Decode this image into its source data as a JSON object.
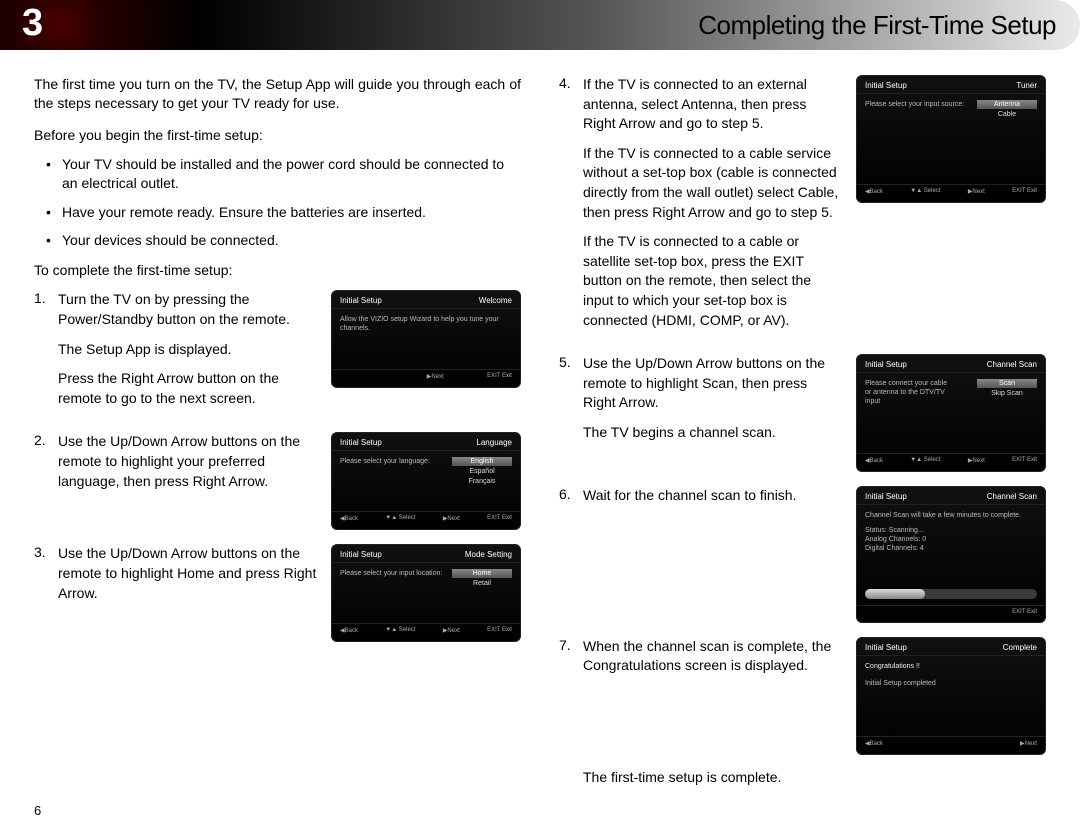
{
  "chapter": "3",
  "title": "Completing the First-Time Setup",
  "page_number": "6",
  "intro": "The first time you turn on the TV, the Setup App will guide you through each of the steps necessary to get your TV ready for use.",
  "before_label": "Before you begin the first-time setup:",
  "bullets": [
    "Your TV should be installed and the power cord should be connected to an electrical outlet.",
    "Have your remote ready. Ensure the batteries are inserted.",
    "Your devices should be connected."
  ],
  "complete_label": "To complete the first-time setup:",
  "steps_left": [
    {
      "lines": [
        "Turn the TV on by pressing the Power/Standby button on the remote.",
        "The Setup App is displayed.",
        "Press the Right Arrow button on the remote to go to the next screen."
      ],
      "tv": {
        "title": "Initial Setup",
        "sub": "Welcome",
        "msg": "Allow the VIZIO setup Wizard to help you tune your channels.",
        "footer": [
          "",
          "",
          "▶Next",
          "EXIT Exit"
        ]
      }
    },
    {
      "lines": [
        "Use the Up/Down Arrow buttons on the remote to highlight your preferred language, then press Right Arrow."
      ],
      "tv": {
        "title": "Initial Setup",
        "sub": "Language",
        "msg": "Please select your language:",
        "options": [
          "English",
          "Español",
          "Français"
        ],
        "footer": [
          "◀Back",
          "▼▲ Select",
          "▶Next",
          "EXIT Exit"
        ]
      }
    },
    {
      "lines": [
        "Use the Up/Down Arrow buttons on the remote to highlight Home and press Right Arrow."
      ],
      "tv": {
        "title": "Initial Setup",
        "sub": "Mode Setting",
        "msg": "Please select your input location:",
        "options": [
          "Home",
          "Retail"
        ],
        "footer": [
          "◀Back",
          "▼▲ Select",
          "▶Next",
          "EXIT Exit"
        ]
      }
    }
  ],
  "steps_right": [
    {
      "lines": [
        "If the TV is connected to an external antenna, select Antenna, then press Right Arrow and go to step 5.",
        "If the TV is connected to a cable service without a set-top box (cable is connected directly from the wall outlet) select Cable, then press Right Arrow and go to step 5.",
        "If the TV is connected to a cable or satellite set-top box, press the EXIT button on the remote, then select the input to which your set-top box is connected (HDMI, COMP, or AV)."
      ],
      "tv": {
        "title": "Initial Setup",
        "sub": "Tuner",
        "msg": "Please select your input source:",
        "options": [
          "Antenna",
          "Cable"
        ],
        "footer": [
          "◀Back",
          "▼▲ Select",
          "▶Next",
          "EXIT Exit"
        ]
      }
    },
    {
      "lines": [
        "Use the Up/Down Arrow buttons on the remote to highlight Scan, then press Right Arrow.",
        "The TV begins a channel scan."
      ],
      "tv": {
        "title": "Initial Setup",
        "sub": "Channel Scan",
        "msg": "Please connect your cable or antenna to the DTV/TV input",
        "options": [
          "Scan",
          "Skip Scan"
        ],
        "footer": [
          "◀Back",
          "▼▲ Select",
          "▶Next",
          "EXIT Exit"
        ]
      }
    },
    {
      "lines": [
        "Wait for the channel scan to finish."
      ],
      "tv": {
        "title": "Initial Setup",
        "sub": "Channel Scan",
        "msg": "Channel Scan will take a few minutes to complete.",
        "status": [
          "Status: Scanning...",
          "Analog Channels: 0",
          "Digital Channels: 4"
        ],
        "progress": true,
        "footer": [
          "",
          "",
          "",
          "EXIT Exit"
        ]
      }
    },
    {
      "lines": [
        "When the channel scan is complete, the Congratulations screen is displayed."
      ],
      "tv": {
        "title": "Initial Setup",
        "sub": "Complete",
        "msg": "Congratulations !!",
        "msg2": "Initial Setup completed",
        "footer": [
          "◀Back",
          "",
          "",
          "▶Next"
        ]
      }
    }
  ],
  "closing": "The first-time setup is complete."
}
